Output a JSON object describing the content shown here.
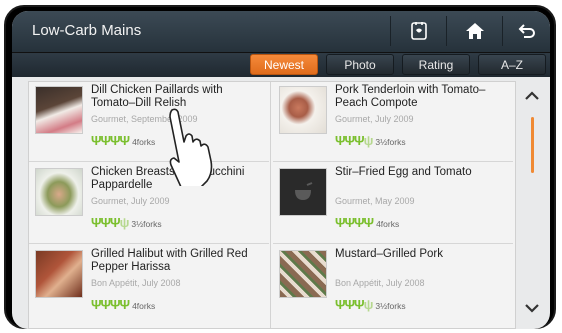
{
  "header": {
    "title": "Low-Carb Mains"
  },
  "toolbar": {
    "icons": [
      "recipe-card-icon",
      "home-icon",
      "back-icon"
    ]
  },
  "sort_tabs": [
    {
      "label": "Newest",
      "active": true
    },
    {
      "label": "Photo",
      "active": false
    },
    {
      "label": "Rating",
      "active": false
    },
    {
      "label": "A–Z",
      "active": false
    }
  ],
  "recipes": [
    {
      "title": "Dill Chicken Paillards with Tomato–Dill Relish",
      "source": "Gourmet, September 2009",
      "forks": "4forks"
    },
    {
      "title": "Pork Tenderloin with Tomato–Peach Compote",
      "source": "Gourmet, July 2009",
      "forks": "3½forks"
    },
    {
      "title": "Chicken Breasts with Zucchini Pappardelle",
      "source": "Gourmet, July 2009",
      "forks": "3½forks"
    },
    {
      "title": "Stir–Fried Egg and Tomato",
      "source": "Gourmet, May 2009",
      "forks": "4forks"
    },
    {
      "title": "Grilled Halibut with Grilled Red Pepper Harissa",
      "source": "Bon Appétit, July 2008",
      "forks": "4forks"
    },
    {
      "title": "Mustard–Grilled Pork",
      "source": "Bon Appétit, July 2008",
      "forks": "3½forks"
    }
  ],
  "colors": {
    "accent": "#e8761f",
    "fork_green": "#7bbf2e",
    "titlebar": "#2c3943"
  }
}
